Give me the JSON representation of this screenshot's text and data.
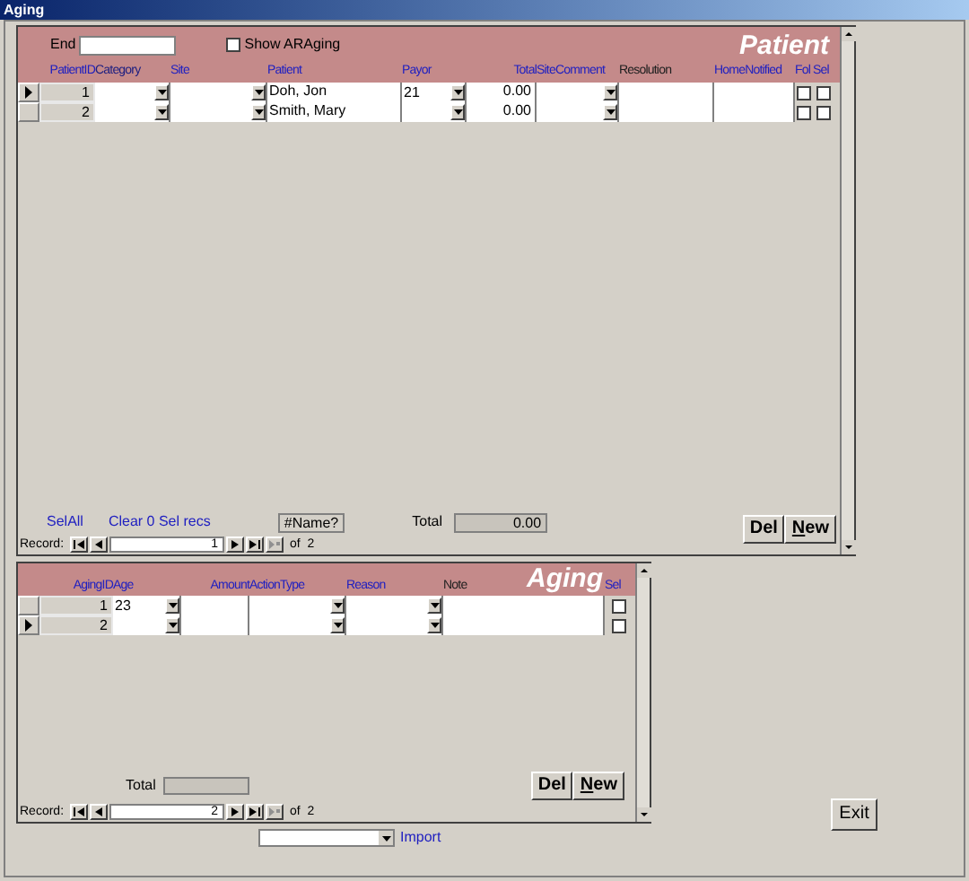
{
  "window": {
    "title": "Aging"
  },
  "patient_form": {
    "filter": {
      "label": "End"
    },
    "show_araging": {
      "label": "Show ARAging",
      "checked": false
    },
    "heading": "Patient",
    "columns": [
      {
        "label": "PatientID",
        "kind": "id",
        "color": "#2020c0"
      },
      {
        "label": "Category",
        "kind": "combo",
        "color": "#202080"
      },
      {
        "label": "Site",
        "kind": "combo",
        "color": "#2020c0"
      },
      {
        "label": "Patient",
        "kind": "text",
        "color": "#2020c0"
      },
      {
        "label": "Payor",
        "kind": "combo",
        "color": "#2020c0"
      },
      {
        "label": "Total",
        "kind": "number",
        "color": "#2020c0"
      },
      {
        "label": "SiteComment",
        "kind": "combo",
        "color": "#2020c0"
      },
      {
        "label": "Resolution",
        "kind": "text",
        "color": "#202020"
      },
      {
        "label": "HomeNotified",
        "kind": "text",
        "color": "#2020c0"
      },
      {
        "label": "Fol",
        "kind": "check",
        "color": "#2020c0"
      },
      {
        "label": "Sel",
        "kind": "check",
        "color": "#2020c0"
      }
    ],
    "rows": [
      {
        "selected": true,
        "cells": [
          {
            "value": "1"
          },
          {},
          {},
          {
            "value": "Doh, Jon"
          },
          {
            "value": "21"
          },
          {
            "value": "0.00"
          },
          {},
          {},
          {},
          {
            "checked": false
          },
          {
            "checked": false
          }
        ]
      },
      {
        "selected": false,
        "cells": [
          {
            "value": "2"
          },
          {},
          {},
          {
            "value": "Smith, Mary"
          },
          {},
          {
            "value": "0.00"
          },
          {},
          {},
          {},
          {
            "checked": false
          },
          {
            "checked": false
          }
        ]
      }
    ],
    "select_all": "SelAll",
    "clear": "Clear 0 Sel recs",
    "name_field": "#Name?",
    "total_label": "Total",
    "total_value": "0.00",
    "buttons": [
      "Del",
      "New"
    ],
    "navigator": {
      "label": "Record:",
      "current": "1",
      "of": "of  2"
    }
  },
  "aging_form": {
    "heading": "Aging",
    "columns": [
      {
        "label": "AgingID",
        "kind": "id",
        "color": "#2020c0"
      },
      {
        "label": "Age",
        "kind": "combo",
        "color": "#2020c0"
      },
      {
        "label": "Amount",
        "kind": "number",
        "color": "#2020c0"
      },
      {
        "label": "ActionType",
        "kind": "combo",
        "color": "#2020c0"
      },
      {
        "label": "Reason",
        "kind": "combo",
        "color": "#2020c0"
      },
      {
        "label": "Note",
        "kind": "text",
        "color": "#202020"
      },
      {
        "label": "Sel",
        "kind": "check",
        "color": "#2020c0"
      }
    ],
    "rows": [
      {
        "selected": false,
        "cells": [
          {
            "value": "1"
          },
          {
            "value": "23"
          },
          {},
          {},
          {},
          {},
          {
            "checked": false
          }
        ]
      },
      {
        "selected": true,
        "cells": [
          {
            "value": "2"
          },
          {},
          {},
          {},
          {},
          {},
          {
            "checked": false
          }
        ]
      }
    ],
    "total_label": "Total",
    "buttons": [
      "Del",
      "New"
    ],
    "navigator": {
      "label": "Record:",
      "current": "2",
      "of": "of  2"
    }
  },
  "import": {
    "link": "Import"
  },
  "exit_button": "Exit"
}
